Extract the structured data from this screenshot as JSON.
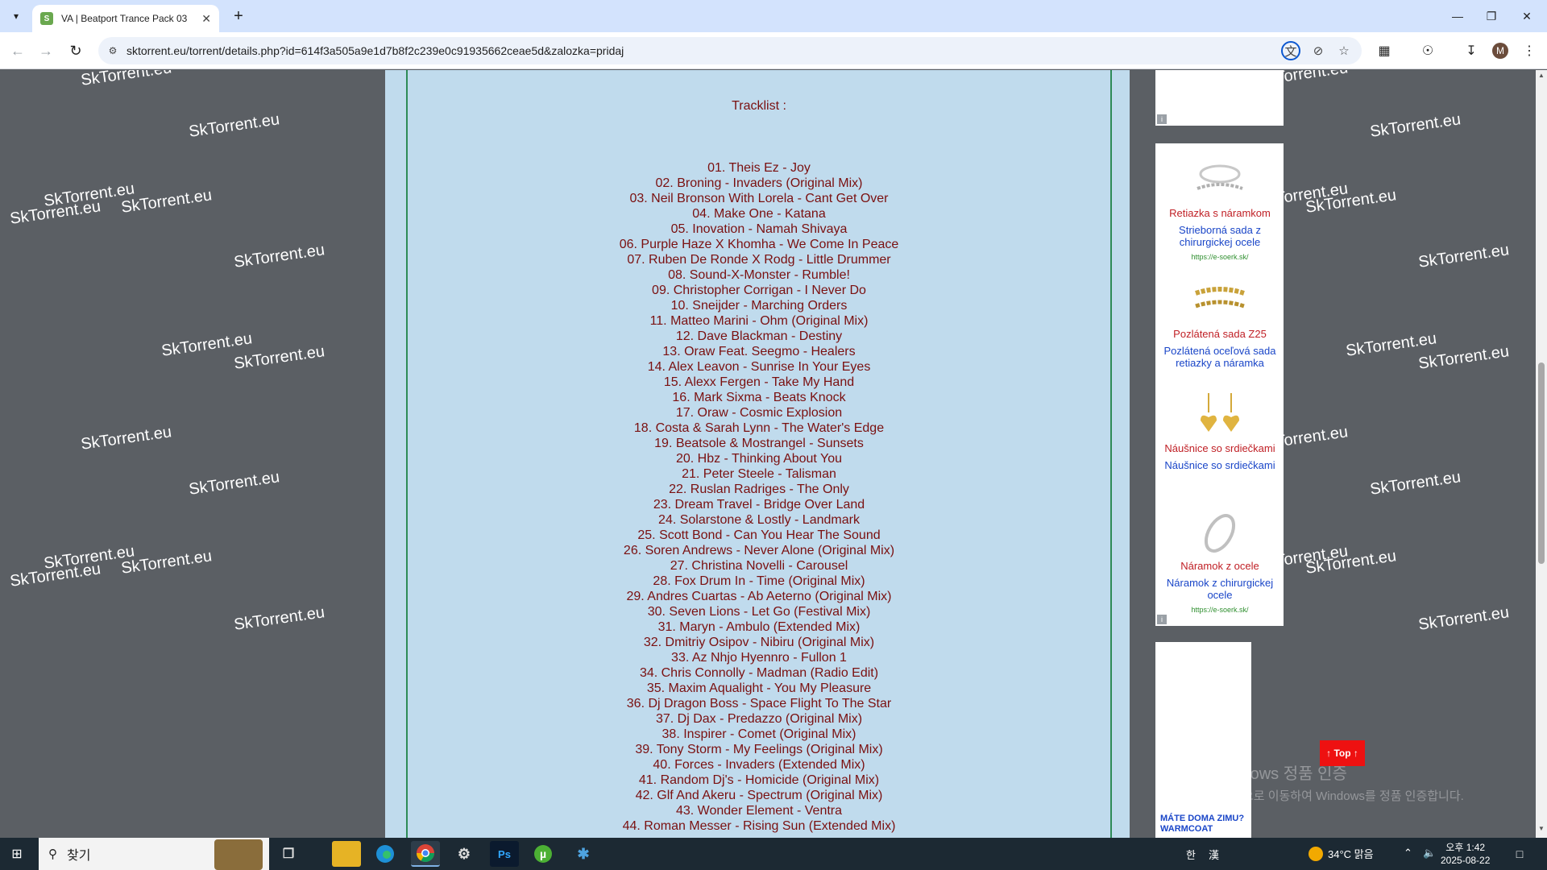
{
  "browser": {
    "tab_title": "VA | Beatport Trance Pack 03",
    "url": "sktorrent.eu/torrent/details.php?id=614f3a505a9e1d7b8f2c239e0c91935662ceae5d&zalozka=pridaj",
    "icons": [
      "tab-search-icon",
      "close-icon",
      "plus-icon",
      "back-icon",
      "forward-icon",
      "reload-icon",
      "site-info-icon",
      "translate-icon",
      "eye-off-icon",
      "star-icon",
      "extensions-icon",
      "location-icon",
      "download-icon",
      "menu-icon"
    ],
    "avatar_letter": "M"
  },
  "page": {
    "watermark": "SkTorrent.eu",
    "tracklist_title": "Tracklist :",
    "tracks": [
      "01. Theis Ez - Joy",
      "02. Broning - Invaders (Original Mix)",
      "03. Neil Bronson With Lorela - Cant Get Over",
      "04. Make One - Katana",
      "05. Inovation - Namah Shivaya",
      "06. Purple Haze X Khomha - We Come In Peace",
      "07. Ruben De Ronde X Rodg - Little Drummer",
      "08. Sound-X-Monster - Rumble!",
      "09. Christopher Corrigan - I Never Do",
      "10. Sneijder - Marching Orders",
      "11. Matteo Marini - Ohm (Original Mix)",
      "12. Dave Blackman - Destiny",
      "13. Oraw Feat. Seegmo - Healers",
      "14. Alex Leavon - Sunrise In Your Eyes",
      "15. Alexx Fergen - Take My Hand",
      "16. Mark Sixma - Beats Knock",
      "17. Oraw - Cosmic Explosion",
      "18. Costa & Sarah Lynn - The Water's Edge",
      "19. Beatsole & Mostrangel - Sunsets",
      "20. Hbz - Thinking About You",
      "21. Peter Steele - Talisman",
      "22. Ruslan Radriges - The Only",
      "23. Dream Travel - Bridge Over Land",
      "24. Solarstone & Lostly - Landmark",
      "25. Scott Bond - Can You Hear The Sound",
      "26. Soren Andrews - Never Alone (Original Mix)",
      "27. Christina Novelli - Carousel",
      "28. Fox Drum In - Time (Original Mix)",
      "29. Andres Cuartas - Ab Aeterno (Original Mix)",
      "30. Seven Lions - Let Go (Festival Mix)",
      "31. Maryn - Ambulo (Extended Mix)",
      "32. Dmitriy Osipov - Nibiru (Original Mix)",
      "33. Az Nhjo Hyennro - Fullon 1",
      "34. Chris Connolly - Madman (Radio Edit)",
      "35. Maxim Aqualight - You My Pleasure",
      "36. Dj Dragon Boss - Space Flight To The Star",
      "37. Dj Dax - Predazzo (Original Mix)",
      "38. Inspirer - Comet (Original Mix)",
      "39. Tony Storm - My Feelings (Original Mix)",
      "40. Forces - Invaders (Extended Mix)",
      "41. Random Dj's - Homicide (Original Mix)",
      "42. Glf And Akeru - Spectrum (Original Mix)",
      "43. Wonder Element - Ventra",
      "44. Roman Messer - Rising Sun (Extended Mix)"
    ]
  },
  "ads": {
    "info_label": "i",
    "items": [
      {
        "title": "Retiazka s náramkom",
        "desc": "Strieborná sada z chirurgickej ocele",
        "url": "https://e-soerk.sk/"
      },
      {
        "title": "Pozlátená sada Z25",
        "desc": "Pozlátená oceľová sada retiazky a náramka",
        "url": ""
      },
      {
        "title": "Náušnice so srdiečkami",
        "desc": "Náušnice so srdiečkami",
        "url": ""
      },
      {
        "title": "Náramok z ocele",
        "desc": "Náramok z chirurgickej ocele",
        "url": "https://e-soerk.sk/"
      }
    ],
    "promo_text": "MÁTE DOMA ZIMU? WARMCOAT"
  },
  "top_button": "↑ Top ↑",
  "windows_activation": {
    "title": "Windows 정품 인증",
    "subtitle": "[설정]으로 이동하여 Windows를 정품 인증합니다."
  },
  "taskbar": {
    "search_placeholder": "찾기",
    "apps": [
      "file-explorer",
      "edge",
      "chrome",
      "app-4",
      "photoshop",
      "utorrent",
      "app-7"
    ],
    "ime": "漢",
    "ime_mode": "한",
    "weather": "34°C  맑음",
    "time": "오후 1:42",
    "date": "2025-08-22"
  },
  "colors": {
    "tracklist_text": "#7a1010",
    "panel_bg": "#c0dbed",
    "border": "#2e8b57",
    "ad_title": "#c02026",
    "ad_desc": "#1a46c8",
    "top_button": "#ee1111"
  }
}
